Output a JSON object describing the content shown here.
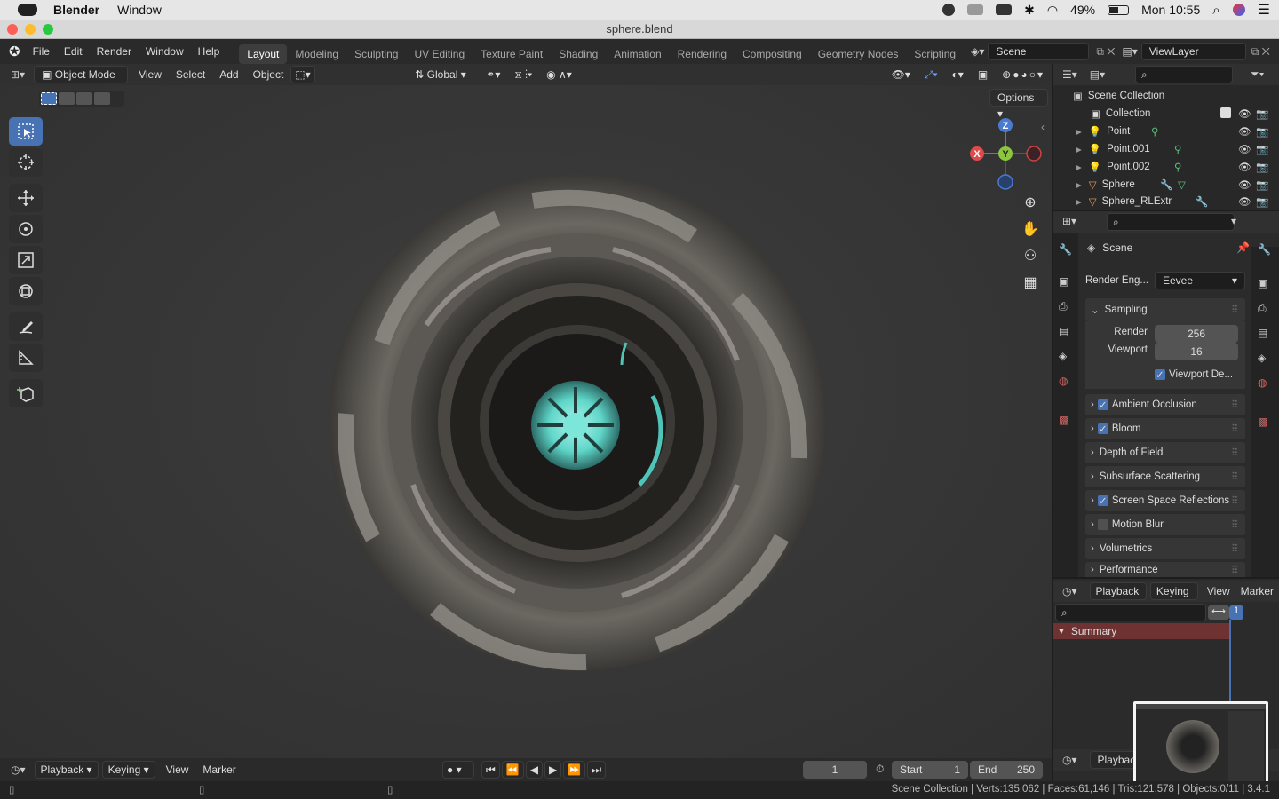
{
  "mac_menubar": {
    "app": "Blender",
    "menu": "Window",
    "battery": "49%",
    "clock": "Mon 10:55"
  },
  "window": {
    "title": "sphere.blend"
  },
  "topbar": {
    "menus": [
      "File",
      "Edit",
      "Render",
      "Window",
      "Help"
    ],
    "workspaces": [
      "Layout",
      "Modeling",
      "Sculpting",
      "UV Editing",
      "Texture Paint",
      "Shading",
      "Animation",
      "Rendering",
      "Compositing",
      "Geometry Nodes",
      "Scripting"
    ],
    "active_workspace": "Layout",
    "scene": "Scene",
    "view_layer": "ViewLayer"
  },
  "viewport_header": {
    "mode": "Object Mode",
    "menus": [
      "View",
      "Select",
      "Add",
      "Object"
    ],
    "transform_orientation": "Global",
    "options": "Options"
  },
  "gizmo": {
    "x": "X",
    "y": "Y",
    "z": "Z"
  },
  "outliner": {
    "root": "Scene Collection",
    "collection": "Collection",
    "items": [
      "Point",
      "Point.001",
      "Point.002",
      "Sphere",
      "Sphere_RLExtr"
    ]
  },
  "properties": {
    "context": "Scene",
    "render_engine_label": "Render Eng...",
    "render_engine": "Eevee",
    "sampling": {
      "title": "Sampling",
      "render_label": "Render",
      "render": "256",
      "viewport_label": "Viewport",
      "viewport": "16",
      "viewport_denoise": "Viewport De..."
    },
    "panels": [
      {
        "label": "Ambient Occlusion",
        "checkbox": true,
        "checked": true
      },
      {
        "label": "Bloom",
        "checkbox": true,
        "checked": true
      },
      {
        "label": "Depth of Field",
        "checkbox": false
      },
      {
        "label": "Subsurface Scattering",
        "checkbox": false
      },
      {
        "label": "Screen Space Reflections",
        "checkbox": true,
        "checked": true
      },
      {
        "label": "Motion Blur",
        "checkbox": true,
        "checked": false
      },
      {
        "label": "Volumetrics",
        "checkbox": false
      },
      {
        "label": "Performance",
        "checkbox": false
      }
    ]
  },
  "dopesheet": {
    "menus": [
      "Playback",
      "Keying",
      "View",
      "Marker"
    ],
    "summary": "Summary",
    "frame": "1",
    "bottom_playback": "Playbac"
  },
  "timeline": {
    "menus": [
      "Playback",
      "Keying",
      "View",
      "Marker"
    ],
    "current_frame": "1",
    "start_label": "Start",
    "start": "1",
    "end_label": "End",
    "end": "250"
  },
  "statusbar": {
    "text": "Scene Collection | Verts:135,062 | Faces:61,146 | Tris:121,578 | Objects:0/11 | 3.4.1"
  }
}
